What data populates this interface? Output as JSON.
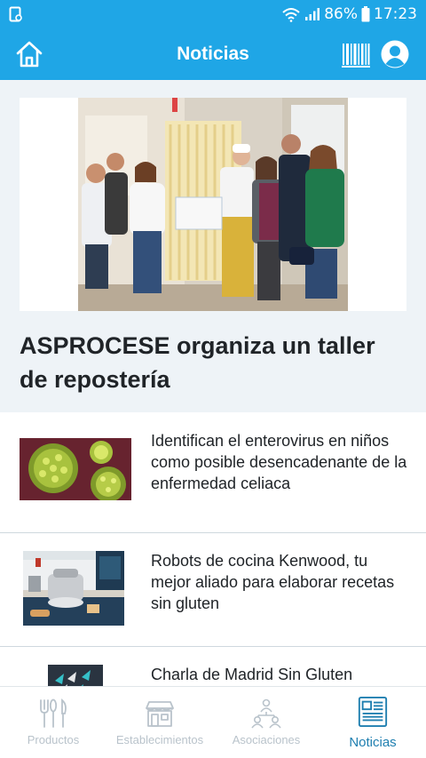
{
  "status_bar": {
    "battery": "86%",
    "time": "17:23"
  },
  "app_bar": {
    "title": "Noticias"
  },
  "featured": {
    "title": "ASPROCESE organiza un taller de repostería"
  },
  "news": [
    {
      "title": "Identifican el enterovirus en niños como posible desencadenante de la enfermedad celiaca",
      "thumb": "virus-image"
    },
    {
      "title": "Robots de cocina Kenwood, tu mejor aliado para elaborar recetas sin gluten",
      "thumb": "kitchen-robot-image"
    },
    {
      "title": "Charla de Madrid Sin Gluten",
      "thumb": "madrid-sin-gluten-image"
    }
  ],
  "bottom_nav": [
    {
      "label": "Productos",
      "icon": "cutlery-icon"
    },
    {
      "label": "Establecimientos",
      "icon": "store-icon"
    },
    {
      "label": "Asociaciones",
      "icon": "people-icon"
    },
    {
      "label": "Noticias",
      "icon": "newspaper-icon",
      "active": true
    }
  ],
  "colors": {
    "primary": "#1fa6e6",
    "nav_active": "#1f7fb0",
    "nav_inactive": "#b9c3cb",
    "featured_bg": "#eef3f7"
  }
}
